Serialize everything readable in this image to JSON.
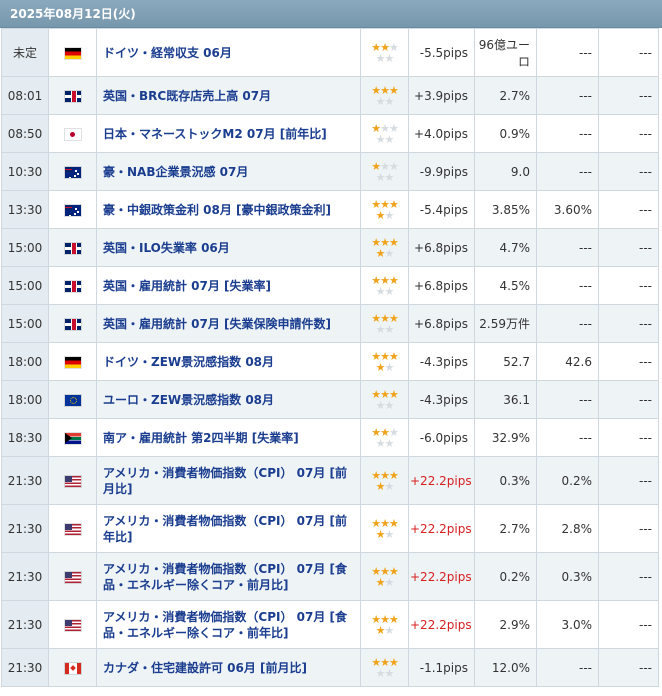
{
  "date_header": "2025年08月12日(火)",
  "rows": [
    {
      "time": "未定",
      "flag": "de",
      "flag_icon": "germany-flag-icon",
      "event": "ドイツ・経常収支 06月",
      "stars": 2,
      "pips": "-5.5pips",
      "result": "96億ユーロ",
      "forecast": "---",
      "previous": "---",
      "h": 48
    },
    {
      "time": "08:01",
      "flag": "uk",
      "flag_icon": "uk-flag-icon",
      "event": "英国・BRC既存店売上高 07月",
      "stars": 3,
      "pips": "+3.9pips",
      "result": "2.7%",
      "forecast": "---",
      "previous": "---",
      "h": 38
    },
    {
      "time": "08:50",
      "flag": "jp",
      "flag_icon": "japan-flag-icon",
      "event": "日本・マネーストックM2 07月 [前年比]",
      "stars": 1,
      "pips": "+4.0pips",
      "result": "0.9%",
      "forecast": "---",
      "previous": "---",
      "h": 38
    },
    {
      "time": "10:30",
      "flag": "au",
      "flag_icon": "australia-flag-icon",
      "event": "豪・NAB企業景況感 07月",
      "stars": 1,
      "pips": "-9.9pips",
      "result": "9.0",
      "forecast": "---",
      "previous": "---",
      "h": 38
    },
    {
      "time": "13:30",
      "flag": "au",
      "flag_icon": "australia-flag-icon",
      "event": "豪・中銀政策金利 08月 [豪中銀政策金利]",
      "stars": 4,
      "pips": "-5.4pips",
      "result": "3.85%",
      "forecast": "3.60%",
      "previous": "---",
      "h": 38
    },
    {
      "time": "15:00",
      "flag": "uk",
      "flag_icon": "uk-flag-icon",
      "event": "英国・ILO失業率 06月",
      "stars": 4,
      "pips": "+6.8pips",
      "result": "4.7%",
      "forecast": "---",
      "previous": "---",
      "h": 38
    },
    {
      "time": "15:00",
      "flag": "uk",
      "flag_icon": "uk-flag-icon",
      "event": "英国・雇用統計 07月 [失業率]",
      "stars": 3,
      "pips": "+6.8pips",
      "result": "4.5%",
      "forecast": "---",
      "previous": "---",
      "h": 38
    },
    {
      "time": "15:00",
      "flag": "uk",
      "flag_icon": "uk-flag-icon",
      "event": "英国・雇用統計 07月 [失業保険申請件数]",
      "stars": 3,
      "pips": "+6.8pips",
      "result": "2.59万件",
      "forecast": "---",
      "previous": "---",
      "h": 38
    },
    {
      "time": "18:00",
      "flag": "de",
      "flag_icon": "germany-flag-icon",
      "event": "ドイツ・ZEW景況感指数 08月",
      "stars": 4,
      "pips": "-4.3pips",
      "result": "52.7",
      "forecast": "42.6",
      "previous": "---",
      "h": 38
    },
    {
      "time": "18:00",
      "flag": "eu",
      "flag_icon": "eu-flag-icon",
      "event": "ユーロ・ZEW景況感指数 08月",
      "stars": 3,
      "pips": "-4.3pips",
      "result": "36.1",
      "forecast": "---",
      "previous": "---",
      "h": 38
    },
    {
      "time": "18:30",
      "flag": "za",
      "flag_icon": "south-africa-flag-icon",
      "event": "南ア・雇用統計 第2四半期 [失業率]",
      "stars": 2,
      "pips": "-6.0pips",
      "result": "32.9%",
      "forecast": "---",
      "previous": "---",
      "h": 38
    },
    {
      "time": "21:30",
      "flag": "us",
      "flag_icon": "usa-flag-icon",
      "event": "アメリカ・消費者物価指数（CPI） 07月 [前月比]",
      "stars": 4,
      "pips": "+22.2pips",
      "result": "0.3%",
      "forecast": "0.2%",
      "previous": "---",
      "h": 48
    },
    {
      "time": "21:30",
      "flag": "us",
      "flag_icon": "usa-flag-icon",
      "event": "アメリカ・消費者物価指数（CPI） 07月 [前年比]",
      "stars": 4,
      "pips": "+22.2pips",
      "result": "2.7%",
      "forecast": "2.8%",
      "previous": "---",
      "h": 48
    },
    {
      "time": "21:30",
      "flag": "us",
      "flag_icon": "usa-flag-icon",
      "event": "アメリカ・消費者物価指数（CPI） 07月 [食品・エネルギー除くコア・前月比]",
      "stars": 4,
      "pips": "+22.2pips",
      "result": "0.2%",
      "forecast": "0.3%",
      "previous": "---",
      "h": 48
    },
    {
      "time": "21:30",
      "flag": "us",
      "flag_icon": "usa-flag-icon",
      "event": "アメリカ・消費者物価指数（CPI） 07月 [食品・エネルギー除くコア・前年比]",
      "stars": 4,
      "pips": "+22.2pips",
      "result": "2.9%",
      "forecast": "3.0%",
      "previous": "---",
      "h": 48
    },
    {
      "time": "21:30",
      "flag": "ca",
      "flag_icon": "canada-flag-icon",
      "event": "カナダ・住宅建設許可 06月 [前月比]",
      "stars": 3,
      "pips": "-1.1pips",
      "result": "12.0%",
      "forecast": "---",
      "previous": "---",
      "h": 38
    }
  ],
  "colors": {
    "header_bg": "#7f9fb4",
    "event_text": "#1a3d8f",
    "star_on": "#f0a21a",
    "star_off": "#d6dbe0",
    "pips_strong": "#d61f1f"
  }
}
